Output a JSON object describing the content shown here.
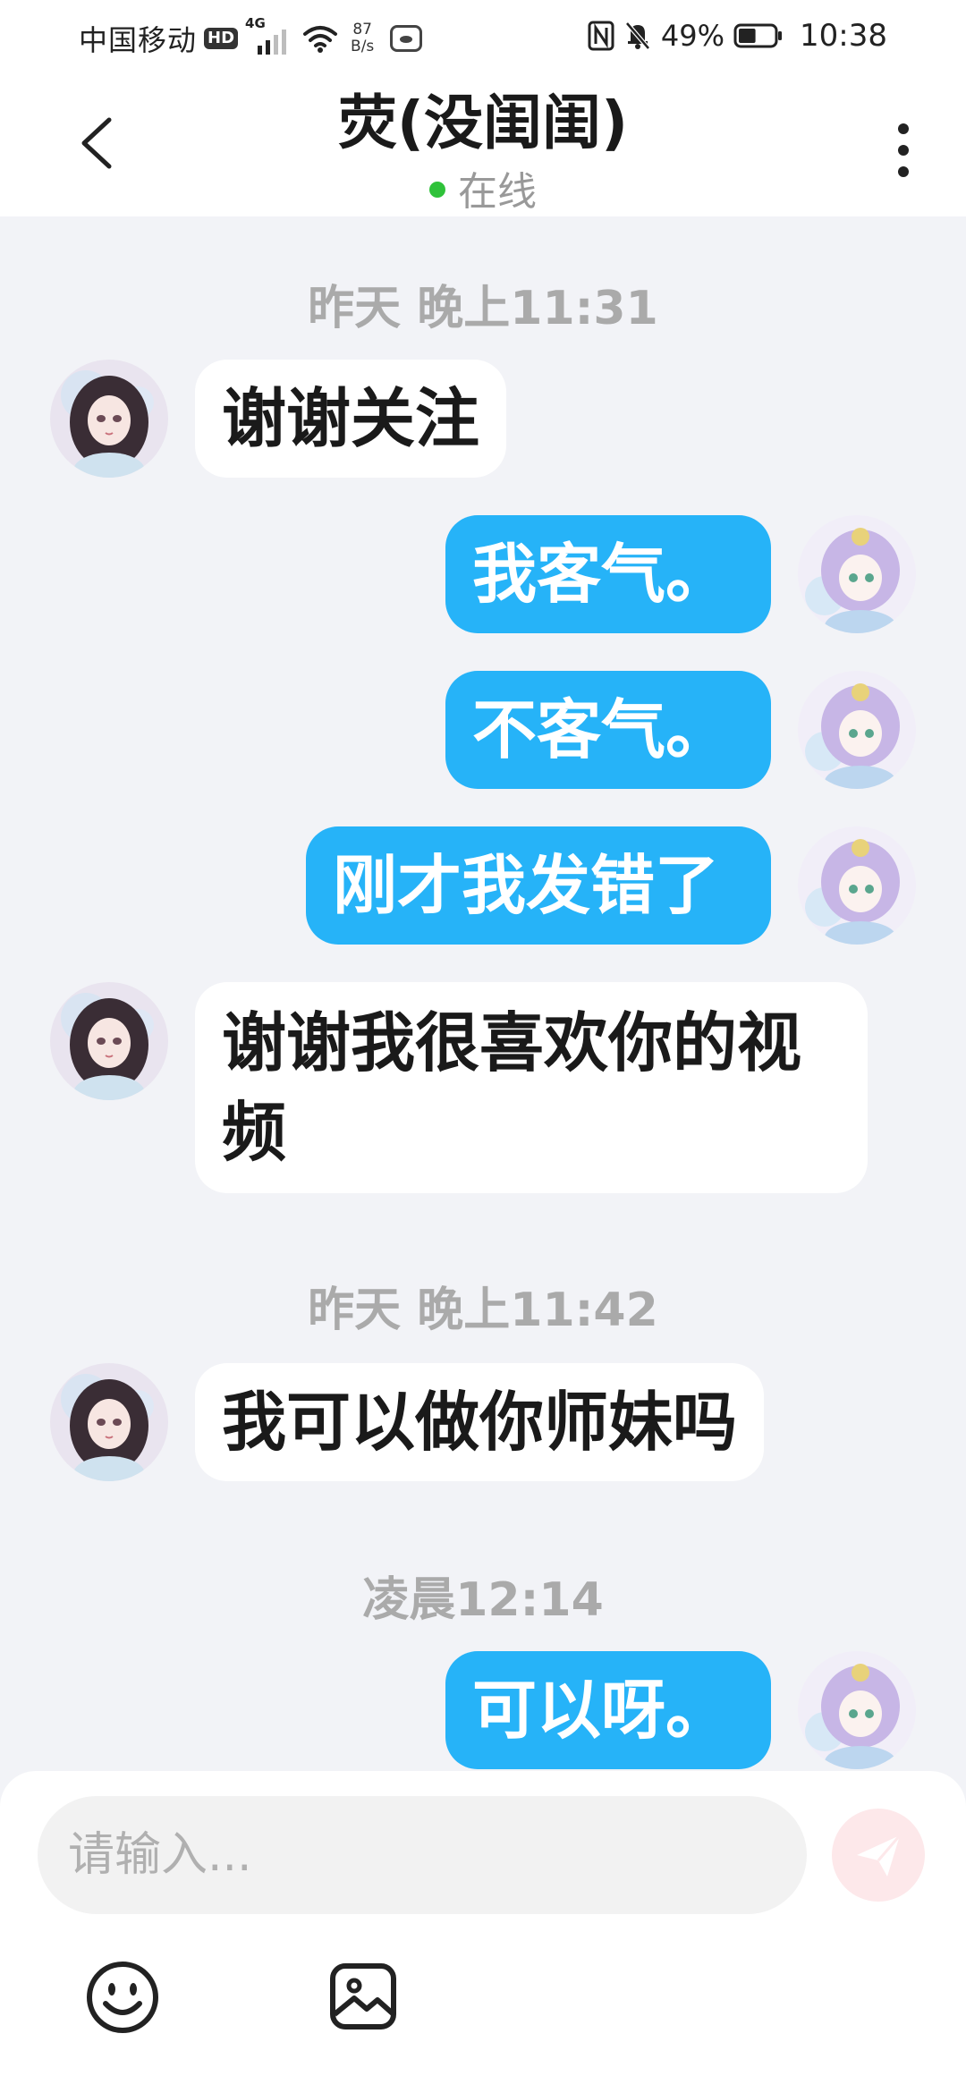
{
  "status_bar": {
    "carrier": "中国移动",
    "hd": "HD",
    "network": "4G",
    "net_speed_value": "87",
    "net_speed_unit": "B/s",
    "battery": "49%",
    "battery_level_fraction": 0.49,
    "time": "10:38"
  },
  "header": {
    "title": "荧(没闺闺)",
    "status": "在线",
    "status_color": "#2fc23a"
  },
  "chat": {
    "timestamps": [
      "昨天 晚上11:31",
      "昨天 晚上11:42",
      "凌晨12:14"
    ],
    "messages": [
      {
        "side": "incoming",
        "text": "谢谢关注"
      },
      {
        "side": "outgoing",
        "text": "我客气。"
      },
      {
        "side": "outgoing",
        "text": "不客气。"
      },
      {
        "side": "outgoing",
        "text": "刚才我发错了"
      },
      {
        "side": "incoming",
        "text": "谢谢我很喜欢你的视频"
      },
      {
        "side": "incoming",
        "text": "我可以做你师妹吗"
      },
      {
        "side": "outgoing",
        "text": "可以呀。"
      }
    ],
    "colors": {
      "outgoing_bubble": "#26b3f8",
      "incoming_bubble": "#ffffff",
      "background": "#f2f3f7"
    }
  },
  "input": {
    "placeholder": "请输入...",
    "send_icon": "paper-plane-icon",
    "emoji_icon": "smiley-icon",
    "image_icon": "image-icon"
  }
}
